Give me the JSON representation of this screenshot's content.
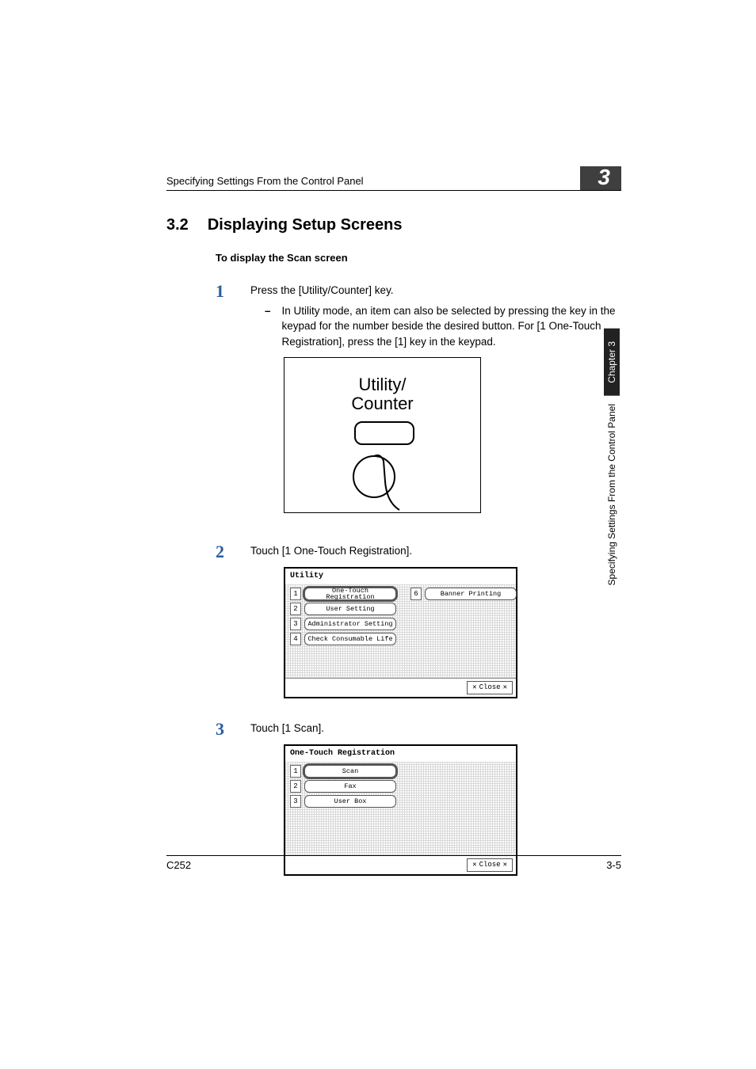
{
  "header": {
    "running_head": "Specifying Settings From the Control Panel",
    "chapter_number": "3"
  },
  "section": {
    "number": "3.2",
    "title": "Displaying Setup Screens",
    "subheading": "To display the Scan screen"
  },
  "steps": {
    "s1": {
      "num": "1",
      "text": "Press the [Utility/Counter] key.",
      "sub_dash": "–",
      "sub_text": "In Utility mode, an item can also be selected by pressing the key in the keypad for the number beside the desired button. For [1 One-Touch Registration], press the [1] key in the keypad."
    },
    "s2": {
      "num": "2",
      "text": "Touch [1 One-Touch Registration]."
    },
    "s3": {
      "num": "3",
      "text": "Touch [1 Scan]."
    }
  },
  "figure1": {
    "line1": "Utility/",
    "line2": "Counter"
  },
  "lcd_utility": {
    "title": "Utility",
    "items": [
      {
        "n": "1",
        "label": "One-Touch Registration",
        "selected": true
      },
      {
        "n": "2",
        "label": "User Setting",
        "selected": false
      },
      {
        "n": "3",
        "label": "Administrator Setting",
        "selected": false
      },
      {
        "n": "4",
        "label": "Check Consumable Life",
        "selected": false
      }
    ],
    "right": {
      "n": "6",
      "label": "Banner Printing"
    },
    "close": "Close"
  },
  "lcd_onetouch": {
    "title": "One-Touch Registration",
    "items": [
      {
        "n": "1",
        "label": "Scan",
        "selected": true
      },
      {
        "n": "2",
        "label": "Fax",
        "selected": false
      },
      {
        "n": "3",
        "label": "User Box",
        "selected": false
      }
    ],
    "close": "Close"
  },
  "side": {
    "chapter": "Chapter 3",
    "text": "Specifying Settings From the Control Panel"
  },
  "footer": {
    "left": "C252",
    "right": "3-5"
  }
}
